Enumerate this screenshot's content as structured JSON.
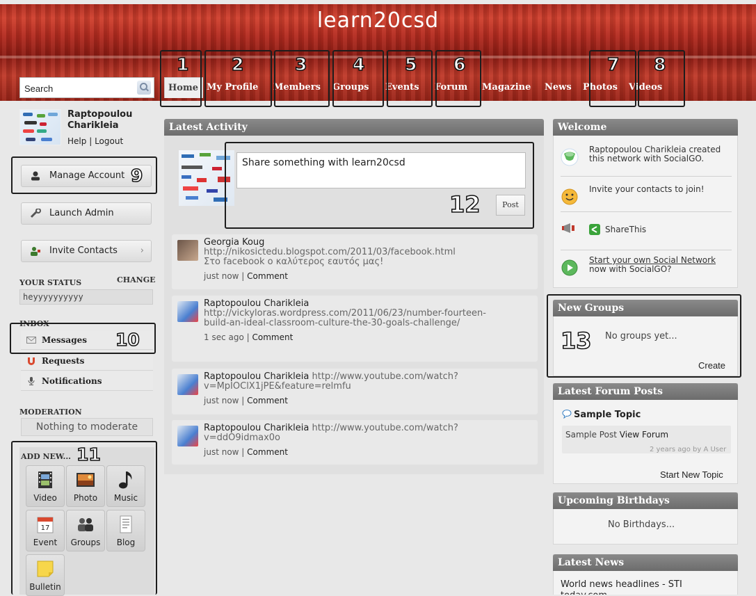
{
  "site": {
    "title": "learn20csd"
  },
  "search": {
    "placeholder": "Search"
  },
  "nav": {
    "items": [
      "Home",
      "My Profile",
      "Members",
      "Groups",
      "Events",
      "Forum",
      "Magazine",
      "News",
      "Photos",
      "Videos"
    ]
  },
  "user": {
    "name": "Raptopoulou Charikleia",
    "help": "Help",
    "sep": "|",
    "logout": "Logout"
  },
  "sidebar": {
    "manage_account": "Manage Account",
    "launch_admin": "Launch Admin",
    "invite_contacts": "Invite Contacts",
    "your_status_label": "YOUR STATUS",
    "change_label": "CHANGE",
    "status_value": "heyyyyyyyyyy",
    "inbox_label": "INBOX",
    "messages": "Messages",
    "requests": "Requests",
    "notifications": "Notifications",
    "moderation_label": "MODERATION",
    "moderation_value": "Nothing to moderate",
    "add_new_label": "ADD NEW...",
    "add_new_items": [
      "Video",
      "Photo",
      "Music",
      "Event",
      "Groups",
      "Blog",
      "Bulletin"
    ]
  },
  "latest_activity": {
    "title": "Latest Activity",
    "share_placeholder": "Share something with learn20csd",
    "post_label": "Post",
    "items": [
      {
        "author": "Georgia Koug",
        "text": "http://nikosictedu.blogspot.com/2011/03/facebook.html",
        "text2": "Στο facebook ο καλύτερος εαυτός μας!",
        "time": "just now",
        "comment": "Comment"
      },
      {
        "author": "Raptopoulou Charikleia",
        "text": "http://vickyloras.wordpress.com/2011/06/23/number-fourteen-build-an-ideal-classroom-culture-the-30-goals-challenge/",
        "time": "1 sec ago",
        "comment": "Comment"
      },
      {
        "author": "Raptopoulou Charikleia",
        "text": "http://www.youtube.com/watch?v=MpIOClX1jPE&feature=relmfu",
        "time": "just now",
        "comment": "Comment"
      },
      {
        "author": "Raptopoulou Charikleia",
        "text": "http://www.youtube.com/watch?v=ddO9idmax0o",
        "time": "just now",
        "comment": "Comment"
      }
    ]
  },
  "welcome": {
    "title": "Welcome",
    "row1": "Raptopoulou Charikleia created this network with SocialGO.",
    "row2": "Invite your contacts to join!",
    "row3": "ShareThis",
    "row4a": "Start your own ",
    "row4b": "Social Network",
    "row4c": " now with SocialGO?"
  },
  "new_groups": {
    "title": "New Groups",
    "empty": "No groups yet...",
    "create": "Create"
  },
  "forum": {
    "title": "Latest Forum Posts",
    "topic": "Sample Topic",
    "post": "Sample Post",
    "view": "View Forum",
    "meta": "2 years ago by A User",
    "start": "Start New Topic"
  },
  "birthdays": {
    "title": "Upcoming Birthdays",
    "empty": "No Birthdays..."
  },
  "news": {
    "title": "Latest News",
    "item": "World news headlines - STI today.com"
  },
  "annotations": [
    "1",
    "2",
    "3",
    "4",
    "5",
    "6",
    "7",
    "8",
    "9",
    "10",
    "11",
    "12",
    "13"
  ],
  "colors": {
    "banner": "#b52c20",
    "panel_header": "#7a7a7a",
    "annotation_box": "#1d1d1d"
  }
}
